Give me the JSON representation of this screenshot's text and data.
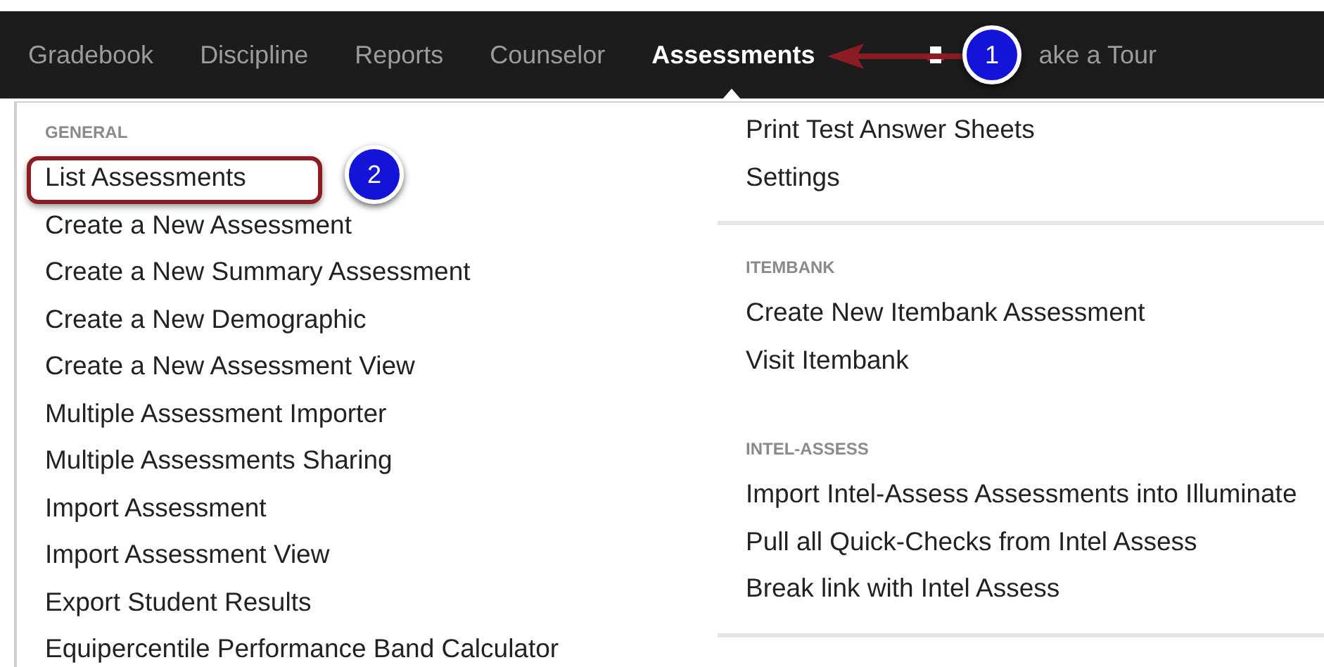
{
  "nav": {
    "items": [
      {
        "label": "Gradebook",
        "selected": false
      },
      {
        "label": "Discipline",
        "selected": false
      },
      {
        "label": "Reports",
        "selected": false
      },
      {
        "label": "Counselor",
        "selected": false
      },
      {
        "label": "Assessments",
        "selected": true
      }
    ],
    "tour": "ake a Tour"
  },
  "menu": {
    "columns": [
      {
        "sections": [
          {
            "header": "GENERAL",
            "divider_after": false,
            "items": [
              {
                "label": "List Assessments",
                "outlined": true
              },
              {
                "label": "Create a New Assessment",
                "outlined": false
              },
              {
                "label": "Create a New Summary Assessment",
                "outlined": false
              },
              {
                "label": "Create a New Demographic",
                "outlined": false
              },
              {
                "label": "Create a New Assessment View",
                "outlined": false
              },
              {
                "label": "Multiple Assessment Importer",
                "outlined": false
              },
              {
                "label": "Multiple Assessments Sharing",
                "outlined": false
              },
              {
                "label": "Import Assessment",
                "outlined": false
              },
              {
                "label": "Import Assessment View",
                "outlined": false
              },
              {
                "label": "Export Student Results",
                "outlined": false
              },
              {
                "label": "Equipercentile Performance Band Calculator",
                "outlined": false
              }
            ]
          }
        ]
      },
      {
        "sections": [
          {
            "divider_after": true,
            "items": [
              {
                "label": "Print Test Answer Sheets",
                "outlined": false
              },
              {
                "label": "Settings",
                "outlined": false
              }
            ]
          },
          {
            "header": "ITEMBANK",
            "divider_after": false,
            "items": [
              {
                "label": "Create New Itembank Assessment",
                "outlined": false
              },
              {
                "label": "Visit Itembank",
                "outlined": false
              }
            ]
          },
          {
            "header": "INTEL-ASSESS",
            "divider_after": true,
            "items": [
              {
                "label": "Import Intel-Assess Assessments into Illuminate",
                "outlined": false
              },
              {
                "label": "Pull all Quick-Checks from Intel Assess",
                "outlined": false
              },
              {
                "label": "Break link with Intel Assess",
                "outlined": false
              }
            ]
          }
        ]
      }
    ]
  },
  "callouts": [
    {
      "number": "1"
    },
    {
      "number": "2"
    }
  ]
}
